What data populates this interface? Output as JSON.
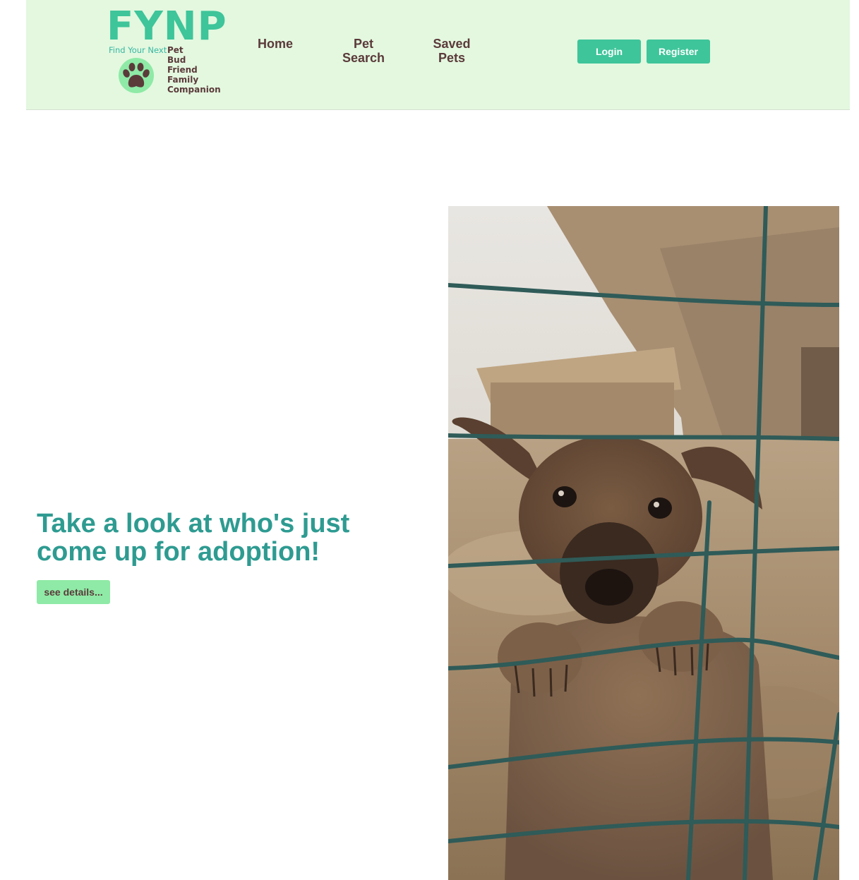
{
  "logo": {
    "title": "FYNP",
    "tagline": "Find Your Next",
    "words": [
      "Pet",
      "Bud",
      "Friend",
      "Family",
      "Companion"
    ]
  },
  "nav": {
    "home": "Home",
    "pet_search_line1": "Pet",
    "pet_search_line2": "Search",
    "saved_pets_line1": "Saved",
    "saved_pets_line2": "Pets"
  },
  "auth": {
    "login": "Login",
    "register": "Register"
  },
  "hero": {
    "heading_line1": "Take a look at who's just",
    "heading_line2": "come up for adoption!",
    "details_button": "see details..."
  },
  "colors": {
    "navbar_bg": "#e3f8df",
    "brand_green": "#3ec59a",
    "heading_teal": "#2e9b91",
    "nav_text": "#5b3a3a",
    "details_button_bg": "#8eeaa6"
  },
  "icons": {
    "logo_paw": "paw-icon"
  }
}
